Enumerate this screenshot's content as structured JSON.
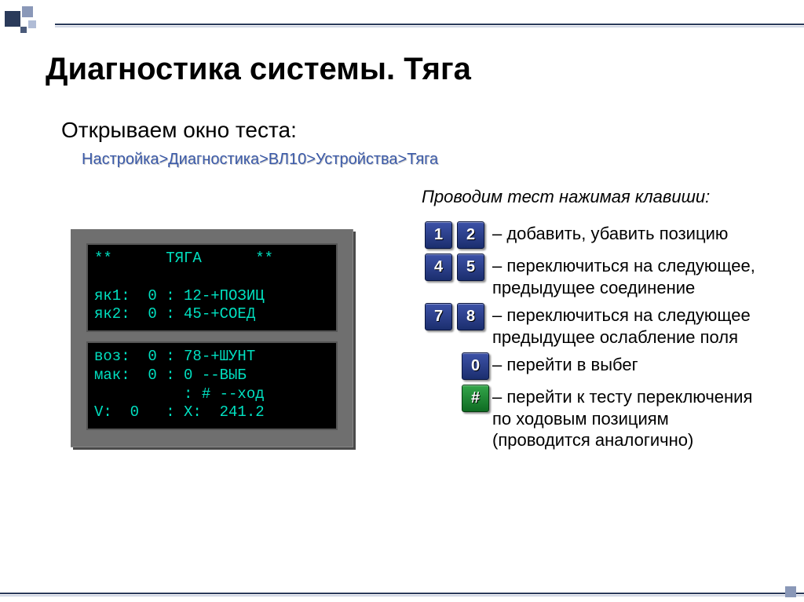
{
  "title": "Диагностика системы. Тяга",
  "subtitle": "Открываем окно теста:",
  "breadcrumb": "Настройка>Диагностика>ВЛ10>Устройства>Тяга",
  "instruction": "Проводим тест нажимая клавиши:",
  "device": {
    "screen1": "**      ТЯГА      **\n\nяк1:  0 : 12-+ПОЗИЦ\nяк2:  0 : 45-+СОЕД",
    "screen2": "воз:  0 : 78-+ШУНТ\nмак:  0 : 0 --ВЫБ\n          : # --ход\nV:  0   : X:  241.2"
  },
  "keys": [
    {
      "caps": [
        "1",
        "2"
      ],
      "single": false,
      "green": false,
      "desc": "– добавить, убавить позицию"
    },
    {
      "caps": [
        "4",
        "5"
      ],
      "single": false,
      "green": false,
      "desc": "– переключиться на следующее, предыдущее соединение"
    },
    {
      "caps": [
        "7",
        "8"
      ],
      "single": false,
      "green": false,
      "desc": "– переключиться на следующее предыдущее ослабление поля"
    },
    {
      "caps": [
        "0"
      ],
      "single": true,
      "green": false,
      "desc": "– перейти в выбег"
    },
    {
      "caps": [
        "#"
      ],
      "single": true,
      "green": true,
      "desc": "– перейти к тесту переключения по ходовым позициям (проводится аналогично)"
    }
  ]
}
